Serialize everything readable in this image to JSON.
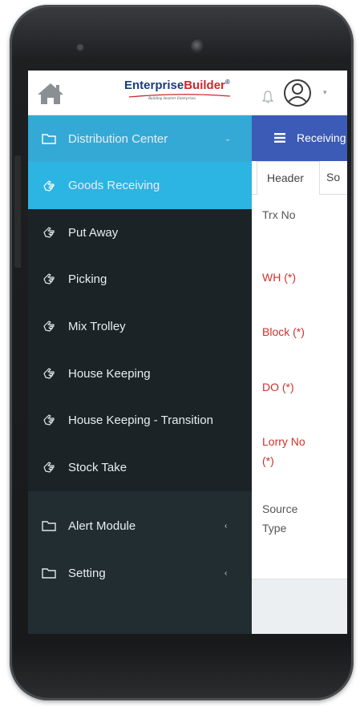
{
  "app": {
    "logo_part1": "Enterprise",
    "logo_part2": "Builder",
    "logo_mark": "®",
    "tagline": "Building Smarter Enterprises",
    "icons": {
      "home": "home-icon",
      "bell": "bell-icon",
      "user": "user-avatar-icon",
      "caret": "▾"
    }
  },
  "sidebar": {
    "parent": {
      "label": "Distribution Center",
      "arrow": "⌄"
    },
    "items": [
      {
        "label": "Goods Receiving",
        "active": true
      },
      {
        "label": "Put Away"
      },
      {
        "label": "Picking"
      },
      {
        "label": "Mix Trolley"
      },
      {
        "label": "House Keeping"
      },
      {
        "label": "House Keeping - Transition"
      },
      {
        "label": "Stock Take"
      }
    ],
    "groups": [
      {
        "label": "Alert Module",
        "arrow": "‹"
      },
      {
        "label": "Setting",
        "arrow": "‹"
      }
    ]
  },
  "content": {
    "title": "Receiving",
    "tabs": [
      "Header",
      "So"
    ],
    "fields": [
      {
        "label": "Trx No",
        "required": false
      },
      {
        "label": "WH (*)",
        "required": true
      },
      {
        "label": "Block (*)",
        "required": true
      },
      {
        "label": "DO (*)",
        "required": true
      },
      {
        "label": "Lorry No (*)",
        "required": true
      },
      {
        "label": "Source Type",
        "required": false
      }
    ]
  },
  "colors": {
    "sidebar_bg": "#1b2327",
    "active_item": "#2cb4e3",
    "header_blue": "#3c5bb7",
    "required_red": "#d0302a"
  }
}
